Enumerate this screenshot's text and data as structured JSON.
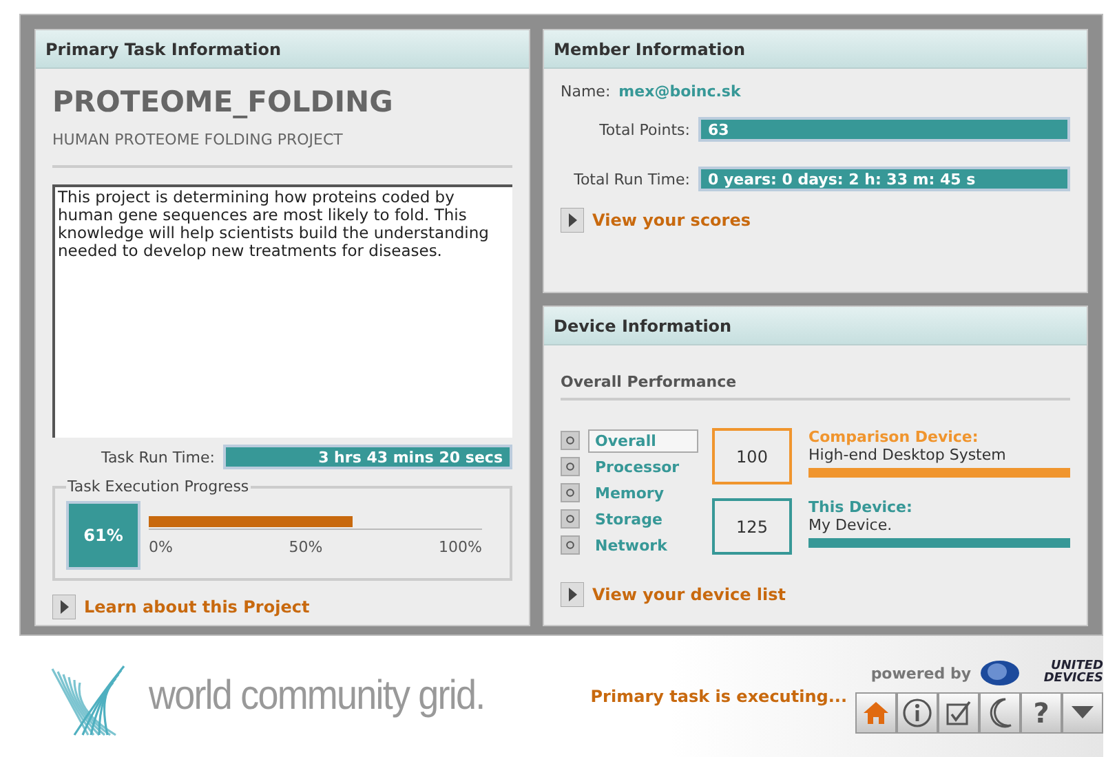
{
  "primary_task": {
    "title": "Primary Task Information",
    "project_code": "PROTEOME_FOLDING",
    "project_name": "HUMAN PROTEOME FOLDING PROJECT",
    "description": "This project is determining how proteins coded by human gene sequences are most likely to fold.  This knowledge will help scientists build the understanding needed to develop new treatments for diseases.",
    "run_time_label": "Task Run Time:",
    "run_time": "3 hrs  43 mins  20 secs",
    "progress": {
      "legend": "Task Execution Progress",
      "percent": "61%",
      "level": 0.61,
      "ticks": [
        "0%",
        "50%",
        "100%"
      ]
    },
    "learn_link": "Learn about this Project"
  },
  "member": {
    "title": "Member Information",
    "name_label": "Name:",
    "name": "mex@boinc.sk",
    "points_label": "Total Points:",
    "points": "63",
    "run_time_label": "Total Run Time:",
    "run_time": "0 years: 0 days: 2 h: 33 m: 45 s",
    "scores_link": "View your scores"
  },
  "device": {
    "title": "Device Information",
    "section": "Overall Performance",
    "categories": [
      {
        "label": "Overall",
        "selected": true
      },
      {
        "label": "Processor",
        "selected": false
      },
      {
        "label": "Memory",
        "selected": false
      },
      {
        "label": "Storage",
        "selected": false
      },
      {
        "label": "Network",
        "selected": false
      }
    ],
    "devices": [
      {
        "score": "100",
        "title": "Comparison Device:",
        "name": "High-end Desktop System",
        "color": "#f0952e"
      },
      {
        "score": "125",
        "title": "This Device:",
        "name": "My Device.",
        "color": "#379897"
      }
    ],
    "device_list_link": "View your device list"
  },
  "footer": {
    "logo": "world community grid.",
    "status": "Primary task is executing...",
    "powered_by": "powered by",
    "partner": "UNITED DEVICES",
    "buttons": [
      {
        "kind": "home"
      },
      {
        "kind": "info"
      },
      {
        "kind": "check"
      },
      {
        "kind": "moon"
      },
      {
        "kind": "help",
        "label": "?"
      },
      {
        "kind": "menu"
      }
    ]
  }
}
